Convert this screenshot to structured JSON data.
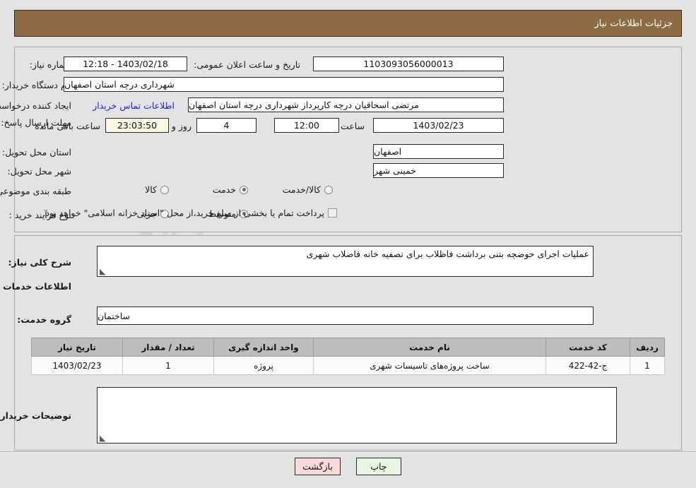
{
  "header": {
    "title": "جزئیات اطلاعات نیاز"
  },
  "theme": {
    "header_bg": "#8d6b44",
    "panel_bg": "#e3e3e3",
    "link_color": "#2020e0",
    "timer_bg": "#fbf8e3",
    "print_btn_bg": "#e7f5e2",
    "back_btn_bg": "#fbd9d9",
    "table_header_bg": "#bdbdbd"
  },
  "top_form": {
    "need_number_label": "شماره نیاز:",
    "need_number_value": "1103093056000013",
    "announce_datetime_label": "تاریخ و ساعت اعلان عمومی:",
    "announce_datetime_value": "1403/02/18 - 12:18",
    "buyer_org_label": "نام دستگاه خریدار:",
    "buyer_org_value": "شهرداری درچه استان اصفهان",
    "creator_label": "ایجاد کننده درخواست:",
    "creator_value": "مرتضی اسحاقیان درچه کارپرداز شهرداری درچه استان اصفهان",
    "contact_link": "اطلاعات تماس خریدار",
    "deadline_label": "مهلت ارسال پاسخ: تا تاریخ:",
    "deadline_date": "1403/02/23",
    "deadline_hour_label": "ساعت",
    "deadline_hour_value": "12:00",
    "remaining_days_value": "4",
    "remaining_days_label": "روز و",
    "remaining_time_value": "23:03:50",
    "remaining_suffix_label": "ساعت باقی مانده",
    "province_label": "استان محل تحویل:",
    "province_value": "اصفهان",
    "city_label": "شهر محل تحویل:",
    "city_value": "خمینی شهر",
    "category_label": "طبقه بندی موضوعی:",
    "category_options": [
      {
        "label": "کالا",
        "selected": false
      },
      {
        "label": "خدمت",
        "selected": true
      },
      {
        "label": "کالا/خدمت",
        "selected": false
      }
    ],
    "process_label": "نوع فرآیند خرید :",
    "process_options": [
      {
        "label": "جزیی",
        "selected": false
      },
      {
        "label": "متوسط",
        "selected": true
      }
    ],
    "treasury_checkbox_label": "پرداخت تمام یا بخشی از مبلغ خرید،از محل \"اسناد خزانه اسلامی\" خواهد بود.",
    "treasury_checked": false
  },
  "middle": {
    "general_desc_label": "شرح کلی نیاز:",
    "general_desc_value": "عملیات اجرای حوضچه بتنی برداشت فاظلاب برای تصفیه خانه فاضلاب شهری",
    "services_section_title": "اطلاعات خدمات مورد نیاز",
    "service_group_label": "گروه خدمت:",
    "service_group_value": "ساختمان",
    "buyer_notes_label": "توضیحات خریدار:",
    "buyer_notes_value": ""
  },
  "table": {
    "columns": [
      "ردیف",
      "کد خدمت",
      "نام خدمت",
      "واحد اندازه گیری",
      "تعداد / مقدار",
      "تاریخ نیاز"
    ],
    "rows": [
      {
        "row": "1",
        "code": "ج-42-422",
        "name": "ساخت پروژه‌های تاسیسات شهری",
        "unit": "پروژه",
        "qty": "1",
        "date": "1403/02/23"
      }
    ]
  },
  "footer": {
    "print_label": "چاپ",
    "back_label": "بازگشت"
  },
  "watermark": {
    "text": "setanaTendeR.net",
    "brand": "TenderNet"
  }
}
